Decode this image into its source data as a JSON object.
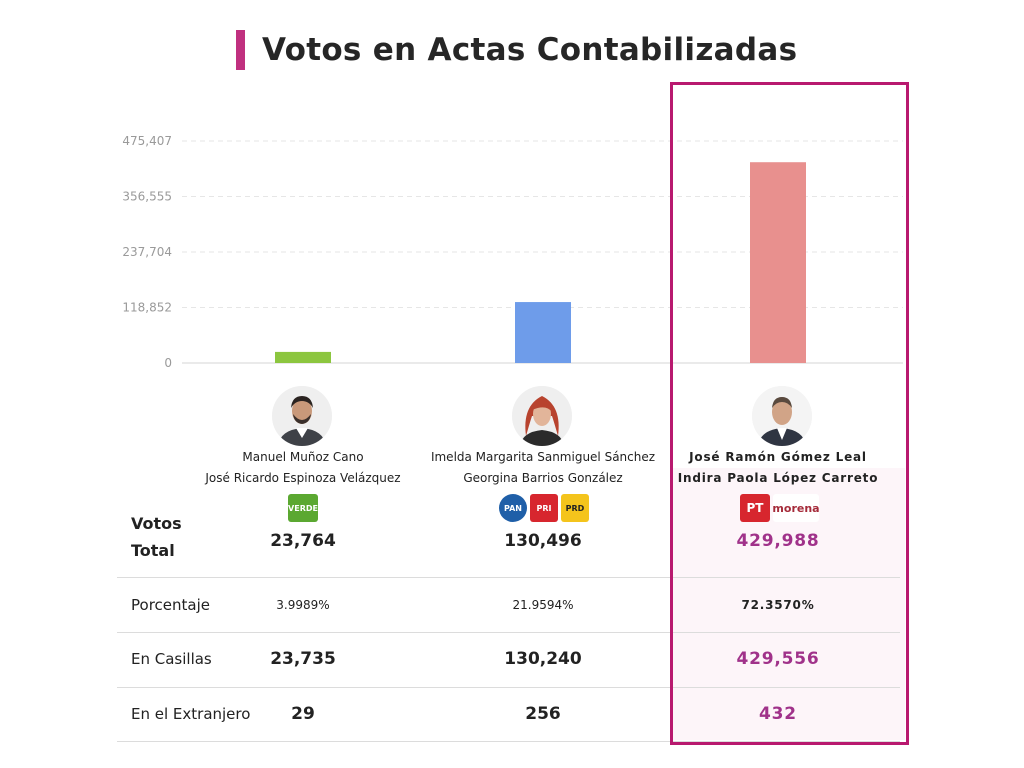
{
  "header": {
    "title": "Votos en Actas Contabilizadas",
    "accent": "#c0307f"
  },
  "chart_data": {
    "type": "bar",
    "categories": [
      "Manuel Muñoz Cano",
      "Imelda Margarita Sanmiguel Sánchez",
      "José Ramón Gómez Leal"
    ],
    "values": [
      23764,
      130496,
      429988
    ],
    "colors": [
      "#8cc63f",
      "#6e9cea",
      "#e8908e"
    ],
    "ylim": [
      0,
      475407
    ],
    "yticks": [
      "475,407",
      "356,555",
      "237,704",
      "118,852",
      "0"
    ],
    "ytick_values": [
      475407,
      356555,
      237704,
      118852,
      0
    ],
    "title": "",
    "xlabel": "",
    "ylabel": "",
    "grid": true
  },
  "candidates": [
    {
      "name": "Manuel Muñoz Cano",
      "substitute": "José Ricardo Espinoza Velázquez",
      "parties": [
        {
          "name": "VERDE",
          "color": "#5ba831"
        }
      ],
      "votos_total": "23,764",
      "porcentaje": "3.9989%",
      "en_casillas": "23,735",
      "en_el_extranjero": "29"
    },
    {
      "name": "Imelda Margarita Sanmiguel Sánchez",
      "substitute": "Georgina Barrios González",
      "parties": [
        {
          "name": "PAN",
          "color": "#1f5fa8"
        },
        {
          "name": "PRI",
          "color": "#d7262e"
        },
        {
          "name": "PRD",
          "color": "#f4c41c"
        }
      ],
      "votos_total": "130,496",
      "porcentaje": "21.9594%",
      "en_casillas": "130,240",
      "en_el_extranjero": "256"
    },
    {
      "name": "José Ramón Gómez Leal",
      "substitute": "Indira Paola López Carreto",
      "parties": [
        {
          "name": "PT",
          "color": "#d7262e"
        },
        {
          "name": "morena",
          "color": "#a52b3a"
        }
      ],
      "votos_total": "429,988",
      "porcentaje": "72.3570%",
      "en_casillas": "429,556",
      "en_el_extranjero": "432"
    }
  ],
  "rows": {
    "votos_total_line1": "Votos",
    "votos_total_line2": "Total",
    "porcentaje": "Porcentaje",
    "en_casillas": "En Casillas",
    "en_el_extranjero": "En el Extranjero"
  },
  "highlight_color": "#b8196f"
}
